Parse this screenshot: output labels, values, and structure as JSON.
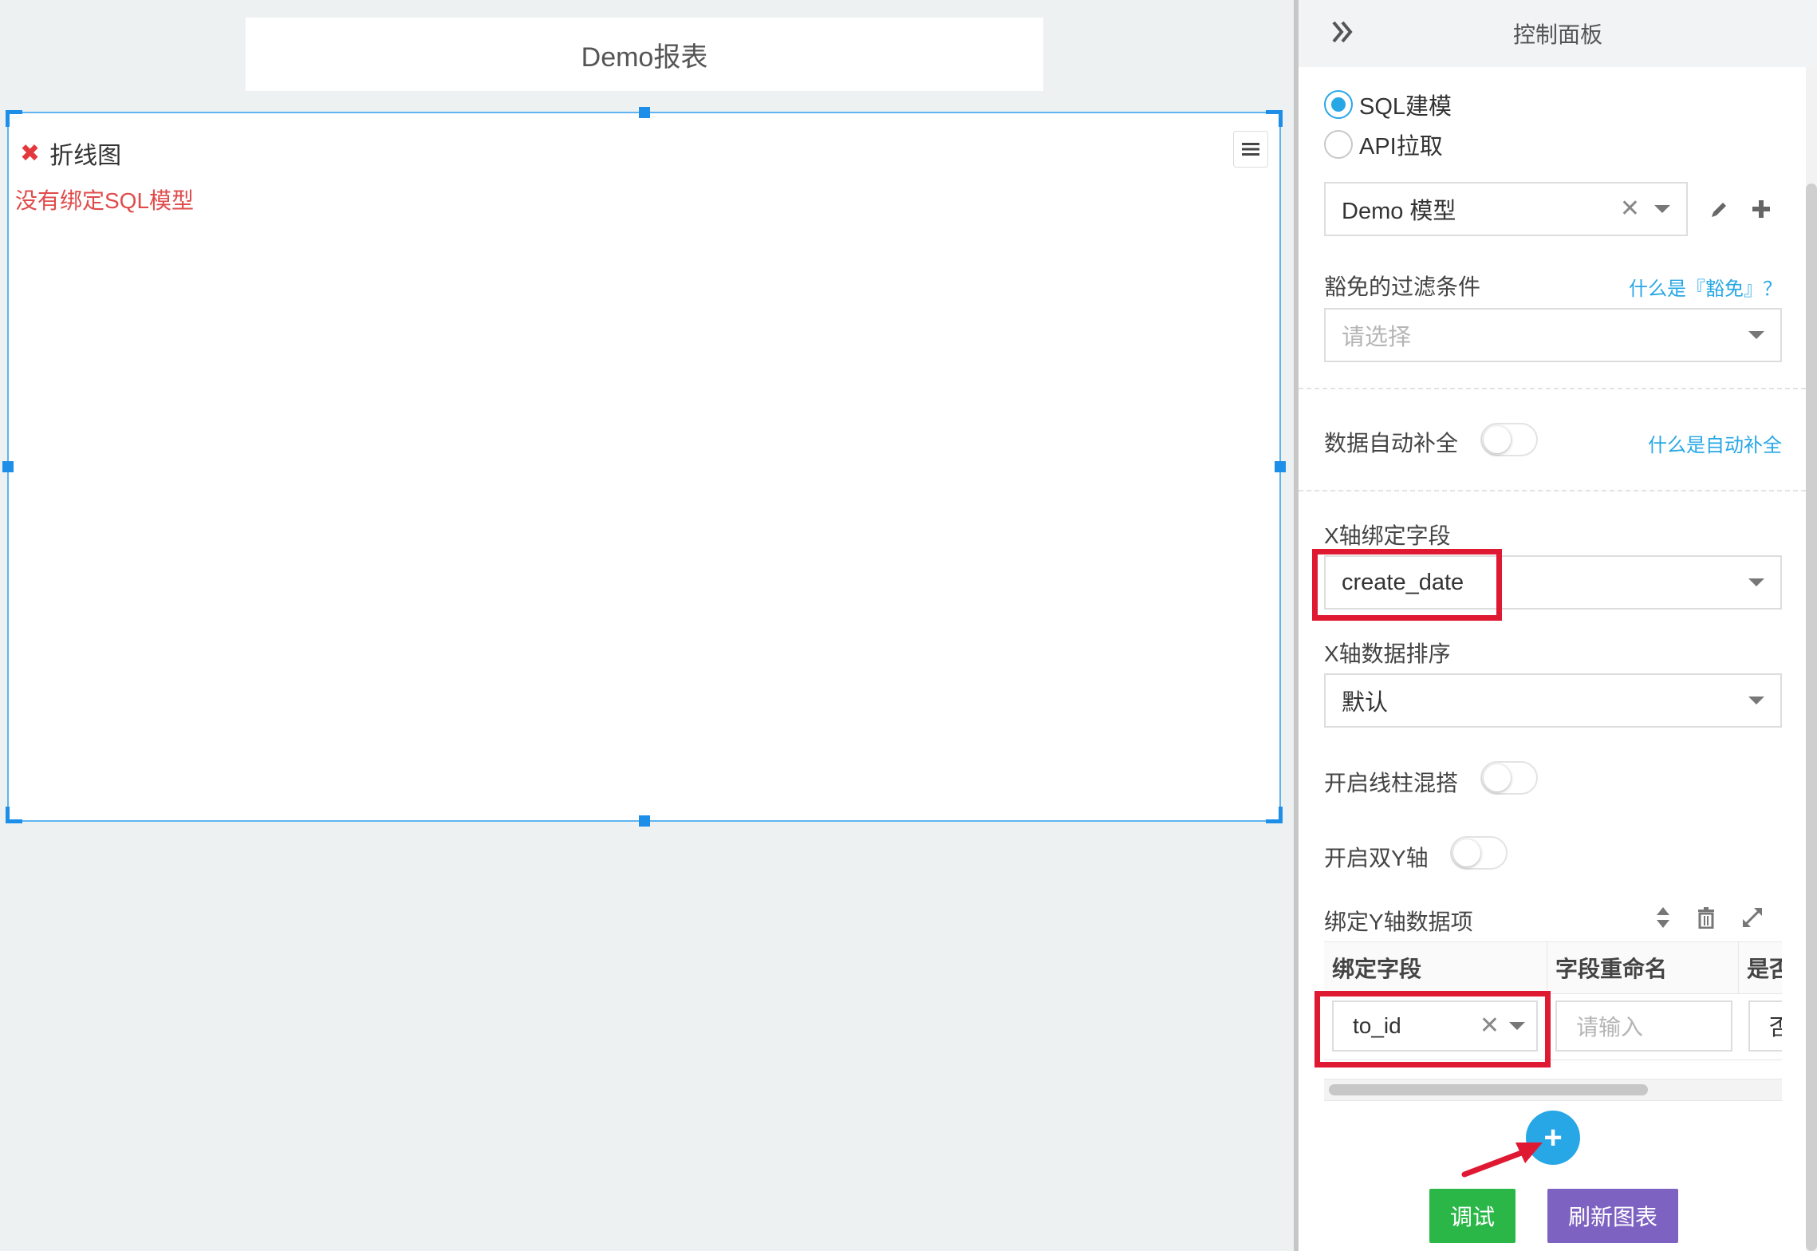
{
  "canvas": {
    "report_title": "Demo报表",
    "widget": {
      "title": "折线图",
      "error": "没有绑定SQL模型"
    }
  },
  "panel": {
    "title": "控制面板",
    "source_options": [
      {
        "label": "SQL建模",
        "selected": true
      },
      {
        "label": "API拉取",
        "selected": false
      }
    ],
    "model_select": {
      "value": "Demo 模型"
    },
    "filter": {
      "label": "豁免的过滤条件",
      "help": "什么是『豁免』？",
      "placeholder": "请选择"
    },
    "auto_fill": {
      "label": "数据自动补全",
      "help": "什么是自动补全",
      "enabled": false
    },
    "x_field": {
      "label": "X轴绑定字段",
      "value": "create_date"
    },
    "x_sort": {
      "label": "X轴数据排序",
      "value": "默认"
    },
    "line_bar_mix": {
      "label": "开启线柱混搭",
      "enabled": false
    },
    "dual_y": {
      "label": "开启双Y轴",
      "enabled": false
    },
    "y_items": {
      "label": "绑定Y轴数据项",
      "columns": [
        "绑定字段",
        "字段重命名",
        "是否"
      ],
      "rows": [
        {
          "field": "to_id",
          "rename_placeholder": "请输入",
          "flag": "否"
        }
      ]
    },
    "buttons": {
      "debug": "调试",
      "refresh": "刷新图表"
    }
  },
  "colors": {
    "accent": "#27a7e6",
    "selection": "#1e8fe8",
    "error_text": "#e04b4b",
    "highlight": "#e01933",
    "debug_button": "#2ab748",
    "refresh_button": "#7e62c2"
  }
}
